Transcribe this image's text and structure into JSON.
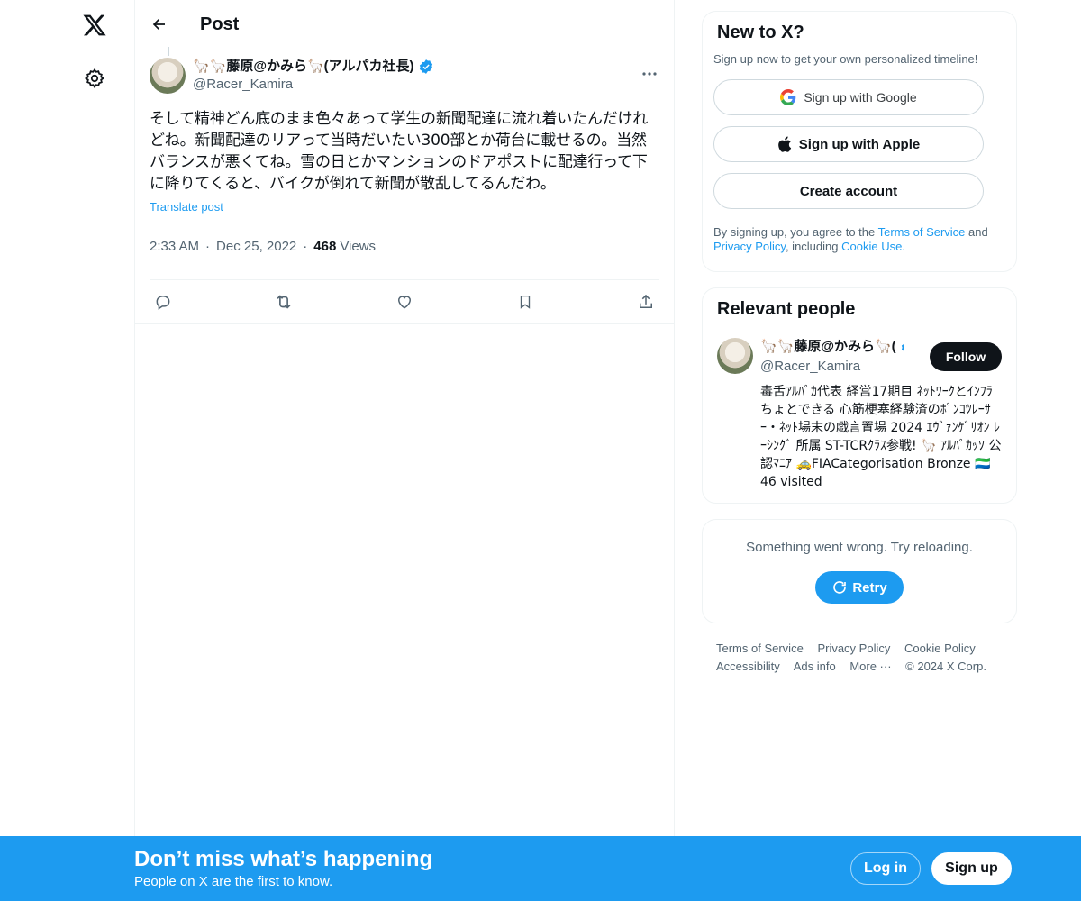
{
  "nav": {
    "logo_icon": "x-logo-icon",
    "settings_icon": "gear-icon"
  },
  "header": {
    "title": "Post",
    "back_icon": "arrow-left-icon"
  },
  "post": {
    "author_name": "🦙🦙藤原@かみら🦙(アルパカ社長)",
    "author_handle": "@Racer_Kamira",
    "text": "そして精神どん底のまま色々あって学生の新聞配達に流れ着いたんだけれ\nどね。新聞配達のリアって当時だいたい300部とか荷台に載せるの。当然\nバランスが悪くてね。雪の日とかマンションのドアポストに配達行って下\nに降りてくると、バイクが倒れて新聞が散乱してるんだわ。",
    "translate_label": "Translate post",
    "time": "2:33 AM",
    "date": "Dec 25, 2022",
    "views_count": "468",
    "views_label": "Views",
    "separator": "·"
  },
  "signup_card": {
    "title": "New to X?",
    "subtitle": "Sign up now to get your own personalized timeline!",
    "google_label": "Sign up with Google",
    "apple_label": "Sign up with Apple",
    "create_label": "Create account",
    "legal_prefix": "By signing up, you agree to the ",
    "terms_link": "Terms of Service",
    "legal_and": " and",
    "privacy_link": "Privacy Policy",
    "legal_including": ", including ",
    "cookie_link": "Cookie Use."
  },
  "relevant": {
    "title": "Relevant people",
    "name": "🦙🦙藤原@かみら🦙(",
    "handle": "@Racer_Kamira",
    "follow_label": "Follow",
    "bio": "毒舌ｱﾙﾊﾟｶ代表 経営17期目 ﾈｯﾄﾜｰｸとｲﾝﾌﾗちょとできる 心筋梗塞経験済のﾎﾟﾝｺﾂﾚｰｻｰ・ﾈｯﾄ場末の戯言置場 2024 ｴｳﾞｧﾝｹﾞﾘｵﾝ ﾚｰｼﾝｸﾞ 所属 ST-TCRｸﾗｽ参戦! 🦙 ｱﾙﾊﾟｶｯｿ 公認ﾏﾆｱ 🚕FIACategorisation Bronze 🇸🇱46 visited"
  },
  "error_card": {
    "message": "Something went wrong. Try reloading.",
    "retry_label": "Retry"
  },
  "footer": {
    "links": [
      "Terms of Service",
      "Privacy Policy",
      "Cookie Policy",
      "Accessibility",
      "Ads info",
      "More ···"
    ],
    "copyright": "© 2024 X Corp."
  },
  "banner": {
    "title": "Don’t miss what’s happening",
    "subtitle": "People on X are the first to know.",
    "login_label": "Log in",
    "signup_label": "Sign up"
  },
  "colors": {
    "accent": "#1d9bf0",
    "text": "#0f1419",
    "muted": "#536471",
    "border": "#eff3f4"
  }
}
